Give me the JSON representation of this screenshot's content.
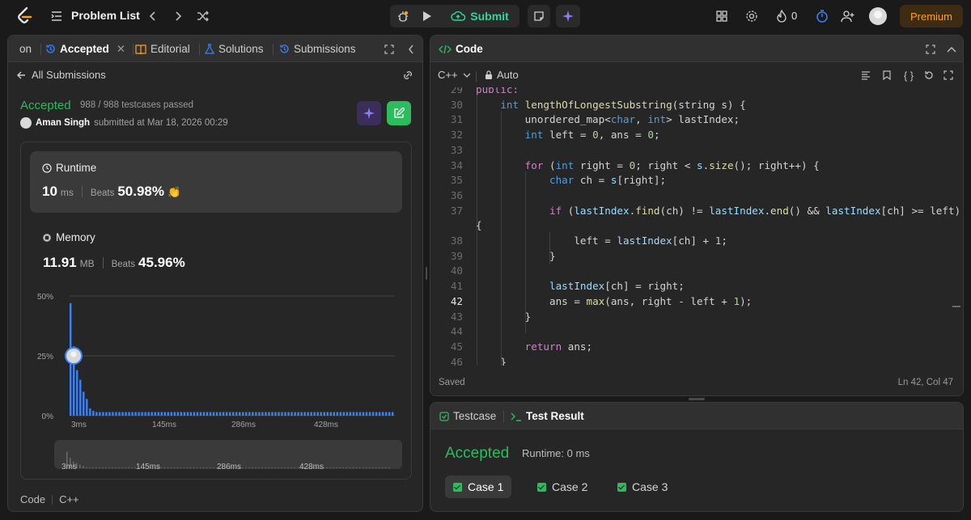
{
  "topbar": {
    "problem_list": "Problem List",
    "submit": "Submit",
    "streak_count": "0",
    "premium": "Premium"
  },
  "left": {
    "tabs": [
      "on",
      "Accepted",
      "Editorial",
      "Solutions",
      "Submissions"
    ],
    "all_submissions": "All Submissions",
    "status": "Accepted",
    "testcases": "988 / 988 testcases passed",
    "author": "Aman Singh",
    "submitted_at": "submitted at Mar 18, 2026 00:29",
    "runtime": {
      "title": "Runtime",
      "value": "10",
      "unit": "ms",
      "beats_label": "Beats",
      "beats_value": "50.98%"
    },
    "memory": {
      "title": "Memory",
      "value": "11.91",
      "unit": "MB",
      "beats_label": "Beats",
      "beats_value": "45.96%"
    },
    "footer_code": "Code",
    "footer_lang": "C++"
  },
  "chart_data": {
    "type": "bar",
    "yticks": [
      "50%",
      "25%",
      "0%"
    ],
    "xticks": [
      "3ms",
      "145ms",
      "286ms",
      "428ms"
    ],
    "ylim": [
      0,
      50
    ],
    "values": [
      47,
      29,
      19,
      15,
      10,
      7,
      3,
      2,
      1.5,
      1.5,
      1.5,
      1.5,
      1.5,
      1.5,
      1.5,
      1.5,
      1.5,
      1.5,
      1.5,
      1.5,
      1.5,
      1.5,
      1.5,
      1.5,
      1.5,
      1.5,
      1.5,
      1.5,
      1.5,
      1.5,
      1.5,
      1.5,
      1.5,
      1.5,
      1.5,
      1.5,
      1.5,
      1.5,
      1.5,
      1.5,
      1.5,
      1.5,
      1.5,
      1.5,
      1.5,
      1.5,
      1.5,
      1.5,
      1.5,
      1.5,
      1.5,
      1.5,
      1.5,
      1.5,
      1.5,
      1.5,
      1.5,
      1.5,
      1.5,
      1.5,
      1.5,
      1.5,
      1.5,
      1.5,
      1.5,
      1.5,
      1.5,
      1.5,
      1.5,
      1.5,
      1.5,
      1.5,
      1.5,
      1.5,
      1.5,
      1.5,
      1.5,
      1.5,
      1.5,
      1.5,
      1.5,
      1.5,
      1.5,
      1.5,
      1.5,
      1.5,
      1.5,
      1.5,
      1.5,
      1.5,
      1.5,
      1.5,
      1.5,
      1.5,
      1.5,
      1.5,
      1.5,
      1.5,
      1.5,
      1.5
    ],
    "highlight_index": 1,
    "bar_color": "#3b82f6"
  },
  "code": {
    "title": "Code",
    "language": "C++",
    "mode": "Auto",
    "saved": "Saved",
    "cursor": "Ln 42, Col 47",
    "current_line": "42"
  },
  "test": {
    "tab_testcase": "Testcase",
    "tab_result": "Test Result",
    "status": "Accepted",
    "runtime": "Runtime: 0 ms",
    "cases": [
      "Case 1",
      "Case 2",
      "Case 3"
    ]
  },
  "colors": {
    "accepted": "#2cbb5d",
    "accent_orange": "#ffa116",
    "bar": "#3b82f6"
  }
}
